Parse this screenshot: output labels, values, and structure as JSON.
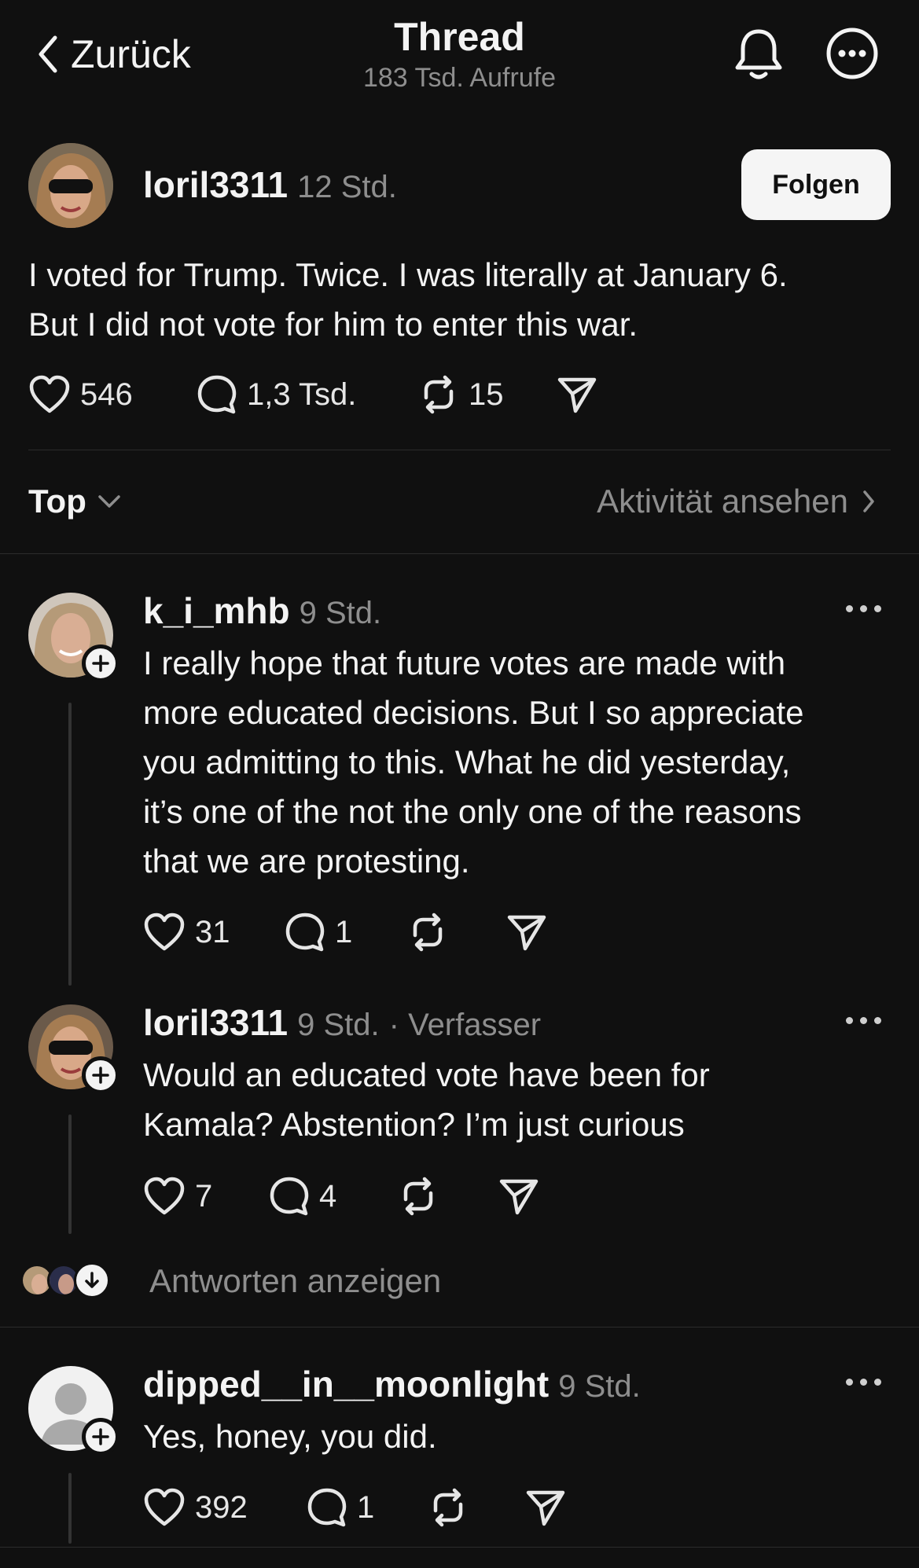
{
  "header": {
    "back_label": "Zurück",
    "title": "Thread",
    "views": "183 Tsd. Aufrufe"
  },
  "post": {
    "username": "loril3311",
    "time": "12 Std.",
    "follow_label": "Folgen",
    "text_line1": "I voted for Trump. Twice. I was literally at January 6.",
    "text_line2": "But I did not vote for him to enter this war.",
    "likes": "546",
    "comments": "1,3 Tsd.",
    "reposts": "15"
  },
  "sort": {
    "label": "Top",
    "activity_label": "Aktivität ansehen"
  },
  "replies": [
    {
      "username": "k_i_mhb",
      "time": "9 Std.",
      "lines": [
        "I really hope that future votes are made with",
        "more educated decisions. But I so appreciate",
        "you admitting to this. What he did yesterday,",
        "it’s one of the not the  only one of the reasons",
        "that we are protesting."
      ],
      "likes": "31",
      "comments": "1"
    },
    {
      "username": "loril3311",
      "time": "9 Std.",
      "author_tag": "· Verfasser",
      "lines": [
        "Would an educated vote have been for",
        "Kamala? Abstention? I’m just curious"
      ],
      "likes": "7",
      "comments": "4"
    },
    {
      "username": "dipped__in__moonlight",
      "time": "9 Std.",
      "lines": [
        "Yes, honey, you did."
      ],
      "likes": "392",
      "comments": "1"
    }
  ],
  "show_replies_label": "Antworten anzeigen",
  "icons": {
    "back": "chevron-left-icon",
    "bell": "bell-icon",
    "more": "more-circle-icon",
    "like": "heart-icon",
    "comment": "comment-icon",
    "repost": "repost-icon",
    "share": "send-icon"
  }
}
